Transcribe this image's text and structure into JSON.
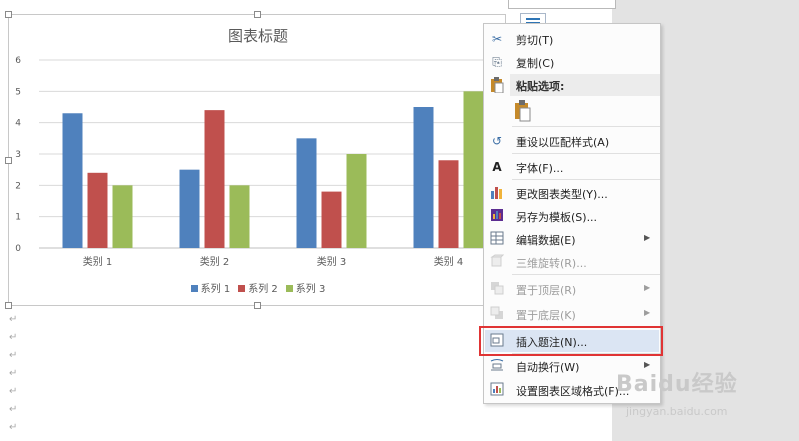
{
  "chart_data": {
    "type": "bar",
    "title": "图表标题",
    "categories": [
      "类别 1",
      "类别 2",
      "类别 3",
      "类别 4"
    ],
    "series": [
      {
        "name": "系列 1",
        "values": [
          4.3,
          2.5,
          3.5,
          4.5
        ],
        "color": "#4f81bd"
      },
      {
        "name": "系列 2",
        "values": [
          2.4,
          4.4,
          1.8,
          2.8
        ],
        "color": "#c0504d"
      },
      {
        "name": "系列 3",
        "values": [
          2,
          2,
          3,
          5
        ],
        "color": "#9bbb59"
      }
    ],
    "yticks": [
      "0",
      "1",
      "2",
      "3",
      "4",
      "5",
      "6"
    ],
    "ylim": [
      0,
      6
    ],
    "grid": true,
    "legend": "bottom"
  },
  "context_menu": {
    "items": [
      {
        "label": "剪切(T)",
        "icon": "scissors-icon",
        "glyph": "✂",
        "enabled": true
      },
      {
        "label": "复制(C)",
        "icon": "copy-icon",
        "glyph": "⎘",
        "enabled": true
      },
      {
        "label": "粘贴选项:",
        "icon": "paste-icon",
        "glyph": "📋",
        "enabled": true
      },
      {
        "label": "重设以匹配样式(A)",
        "icon": "reset-style-icon",
        "glyph": "↺",
        "enabled": true
      },
      {
        "label": "字体(F)...",
        "icon": "font-icon",
        "glyph": "A",
        "enabled": true
      },
      {
        "label": "更改图表类型(Y)...",
        "icon": "chart-type-icon",
        "glyph": "▮",
        "enabled": true
      },
      {
        "label": "另存为模板(S)...",
        "icon": "save-template-icon",
        "glyph": "▦",
        "enabled": true
      },
      {
        "label": "编辑数据(E)",
        "icon": "edit-data-icon",
        "glyph": "▤",
        "enabled": true
      },
      {
        "label": "三维旋转(R)...",
        "icon": "3d-rotation-icon",
        "glyph": "▢",
        "enabled": false
      },
      {
        "label": "置于顶层(R)",
        "icon": "bring-front-icon",
        "glyph": "◰",
        "enabled": false
      },
      {
        "label": "置于底层(K)",
        "icon": "send-back-icon",
        "glyph": "◲",
        "enabled": false
      },
      {
        "label": "插入题注(N)...",
        "icon": "insert-caption-icon",
        "glyph": "▣",
        "enabled": true
      },
      {
        "label": "自动换行(W)",
        "icon": "wrap-text-icon",
        "glyph": "☰",
        "enabled": true
      },
      {
        "label": "设置图表区域格式(F)...",
        "icon": "format-chart-area-icon",
        "glyph": "◩",
        "enabled": true
      }
    ]
  },
  "watermark": {
    "text": "Baidu经验",
    "sub": "jingyan.baidu.com"
  }
}
